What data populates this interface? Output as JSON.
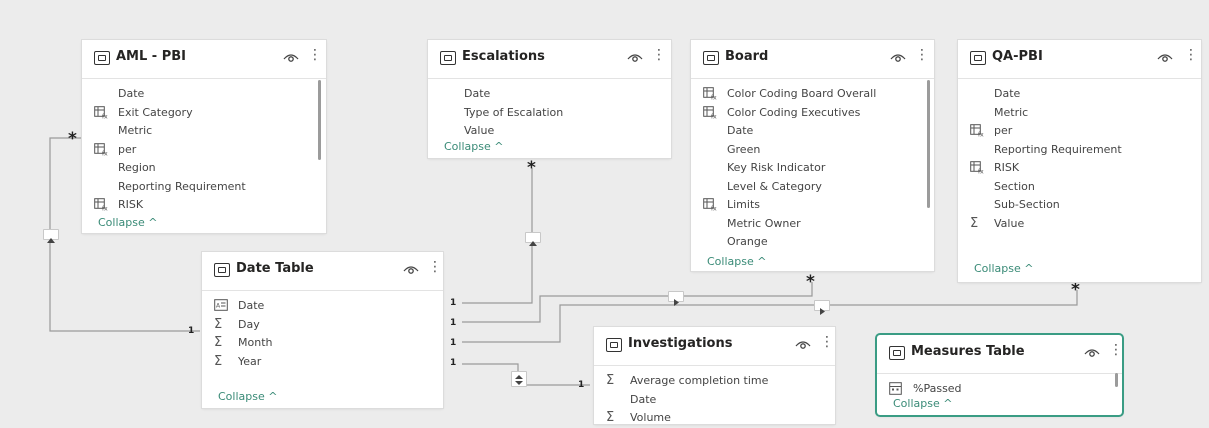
{
  "tables": {
    "aml": {
      "title": "AML - PBI",
      "fields": [
        {
          "label": "Date",
          "icon": ""
        },
        {
          "label": "Exit Category",
          "icon": "calculated-column-icon"
        },
        {
          "label": "Metric",
          "icon": ""
        },
        {
          "label": "per",
          "icon": "calculated-column-icon"
        },
        {
          "label": "Region",
          "icon": ""
        },
        {
          "label": "Reporting Requirement",
          "icon": ""
        },
        {
          "label": "RISK",
          "icon": "calculated-column-icon"
        }
      ],
      "collapse": "Collapse ^"
    },
    "escalations": {
      "title": "Escalations",
      "fields": [
        {
          "label": "Date",
          "icon": ""
        },
        {
          "label": "Type of Escalation",
          "icon": ""
        },
        {
          "label": "Value",
          "icon": ""
        }
      ],
      "collapse": "Collapse ^"
    },
    "board": {
      "title": "Board",
      "fields": [
        {
          "label": "Color Coding Board Overall",
          "icon": "calculated-column-icon"
        },
        {
          "label": "Color Coding Executives",
          "icon": "calculated-column-icon"
        },
        {
          "label": "Date",
          "icon": ""
        },
        {
          "label": "Green",
          "icon": ""
        },
        {
          "label": "Key Risk Indicator",
          "icon": ""
        },
        {
          "label": "Level & Category",
          "icon": ""
        },
        {
          "label": "Limits",
          "icon": "calculated-column-icon"
        },
        {
          "label": "Metric Owner",
          "icon": ""
        },
        {
          "label": "Orange",
          "icon": ""
        }
      ],
      "collapse": "Collapse ^"
    },
    "qa": {
      "title": "QA-PBI",
      "fields": [
        {
          "label": "Date",
          "icon": ""
        },
        {
          "label": "Metric",
          "icon": ""
        },
        {
          "label": "per",
          "icon": "calculated-column-icon"
        },
        {
          "label": "Reporting Requirement",
          "icon": ""
        },
        {
          "label": "RISK",
          "icon": "calculated-column-icon"
        },
        {
          "label": "Section",
          "icon": ""
        },
        {
          "label": "Sub-Section",
          "icon": ""
        },
        {
          "label": "Value",
          "icon": "sigma-icon"
        }
      ],
      "collapse": "Collapse ^"
    },
    "date": {
      "title": "Date Table",
      "fields": [
        {
          "label": "Date",
          "icon": "date-hierarchy-icon"
        },
        {
          "label": "Day",
          "icon": "sigma-icon"
        },
        {
          "label": "Month",
          "icon": "sigma-icon"
        },
        {
          "label": "Year",
          "icon": "sigma-icon"
        }
      ],
      "collapse": "Collapse ^"
    },
    "investigations": {
      "title": "Investigations",
      "fields": [
        {
          "label": "Average completion time",
          "icon": "sigma-icon"
        },
        {
          "label": "Date",
          "icon": ""
        },
        {
          "label": "Volume",
          "icon": "sigma-icon"
        }
      ]
    },
    "measures": {
      "title": "Measures Table",
      "fields": [
        {
          "label": "%Passed",
          "icon": "measure-icon"
        }
      ],
      "collapse": "Collapse ^"
    }
  },
  "relationship_marks": {
    "many": "*",
    "one": "1"
  },
  "colors": {
    "background": "#ececec",
    "accent": "#3a8b77",
    "line": "#9a9a9a"
  }
}
